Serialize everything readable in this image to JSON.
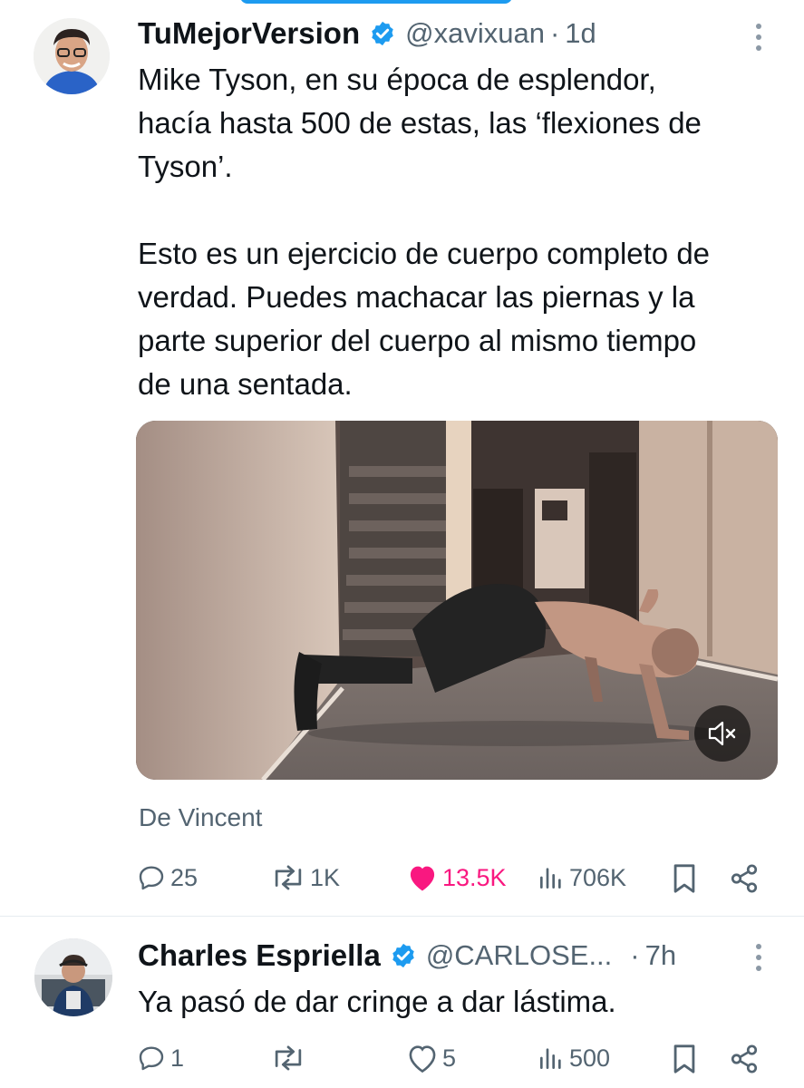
{
  "tweets": [
    {
      "author": "TuMejorVersion",
      "handle": "@xavixuan",
      "separator": "·",
      "time": "1d",
      "text_p1": "Mike Tyson, en su época de esplendor,\nhacía hasta 500 de estas, las ‘flexiones de\nTyson’.",
      "text_p2": "Esto es un ejercicio de cuerpo completo de\nverdad. Puedes machacar las piernas y la\nparte superior del cuerpo al mismo tiempo\nde una sentada.",
      "source": "De Vincent",
      "replies": "25",
      "reposts": "1K",
      "likes": "13.5K",
      "views": "706K"
    },
    {
      "author": "Charles Espriella",
      "handle": "@CARLOSE...",
      "separator": "·",
      "time": "7h",
      "text": "Ya pasó de dar cringe a dar lástima.",
      "replies": "1",
      "reposts": "",
      "likes": "5",
      "views": "500"
    }
  ],
  "colors": {
    "accent": "#1d9bf0",
    "like": "#f91880",
    "muted": "#536471"
  },
  "icons": [
    "verified-badge-icon",
    "more-options-icon",
    "reply-icon",
    "repost-icon",
    "heart-icon",
    "views-icon",
    "bookmark-icon",
    "share-icon",
    "mute-icon"
  ]
}
